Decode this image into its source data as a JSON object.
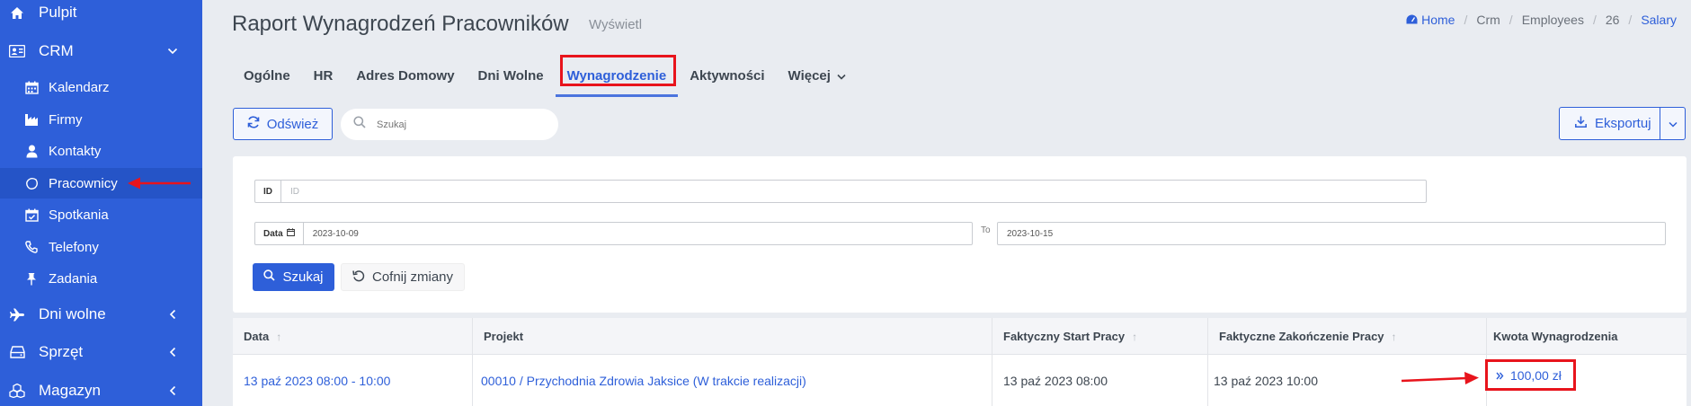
{
  "sidebar": {
    "items": [
      {
        "label": "Pulpit",
        "icon": "home-icon"
      },
      {
        "label": "CRM",
        "icon": "address-card-icon"
      },
      {
        "label": "Dni wolne",
        "icon": "plane-icon"
      },
      {
        "label": "Sprzęt",
        "icon": "hdd-icon"
      },
      {
        "label": "Magazyn",
        "icon": "cubes-icon"
      }
    ],
    "crm_sub": [
      {
        "label": "Kalendarz",
        "icon": "calendar-icon"
      },
      {
        "label": "Firmy",
        "icon": "industry-icon"
      },
      {
        "label": "Kontakty",
        "icon": "user-icon"
      },
      {
        "label": "Pracownicy",
        "icon": "lemon-icon"
      },
      {
        "label": "Spotkania",
        "icon": "calendar-check-icon"
      },
      {
        "label": "Telefony",
        "icon": "phone-icon"
      },
      {
        "label": "Zadania",
        "icon": "thumbtack-icon"
      }
    ]
  },
  "header": {
    "title": "Raport Wynagrodzeń Pracowników",
    "subtitle": "Wyświetl"
  },
  "breadcrumb": {
    "home": "Home",
    "items": [
      "Crm",
      "Employees",
      "26",
      "Salary"
    ]
  },
  "tabs": [
    {
      "label": "Ogólne"
    },
    {
      "label": "HR"
    },
    {
      "label": "Adres Domowy"
    },
    {
      "label": "Dni Wolne"
    },
    {
      "label": "Wynagrodzenie"
    },
    {
      "label": "Aktywności"
    },
    {
      "label": "Więcej"
    }
  ],
  "toolbar": {
    "refresh_label": "Odśwież",
    "search_placeholder": "Szukaj",
    "export_label": "Eksportuj"
  },
  "filters": {
    "id_label": "ID",
    "id_placeholder": "ID",
    "date_label": "Data",
    "date_from": "2023-10-09",
    "to_label": "To",
    "date_to": "2023-10-15",
    "search_label": "Szukaj",
    "reset_label": "Cofnij zmiany"
  },
  "table": {
    "columns": [
      "Data",
      "Projekt",
      "Faktyczny Start Pracy",
      "Faktyczne Zakończenie Pracy",
      "Kwota Wynagrodzenia"
    ],
    "rows": [
      {
        "date": "13 paź 2023 08:00 - 10:00",
        "project": "00010 / Przychodnia Zdrowia Jaksice (W trakcie realizacji)",
        "start": "13 paź 2023 08:00",
        "end": "13 paź 2023 10:00",
        "amount": "100,00 zł"
      }
    ]
  },
  "colors": {
    "accent": "#2e5fd9",
    "sidebar": "#2e5fd9",
    "highlight": "#e8141c"
  }
}
